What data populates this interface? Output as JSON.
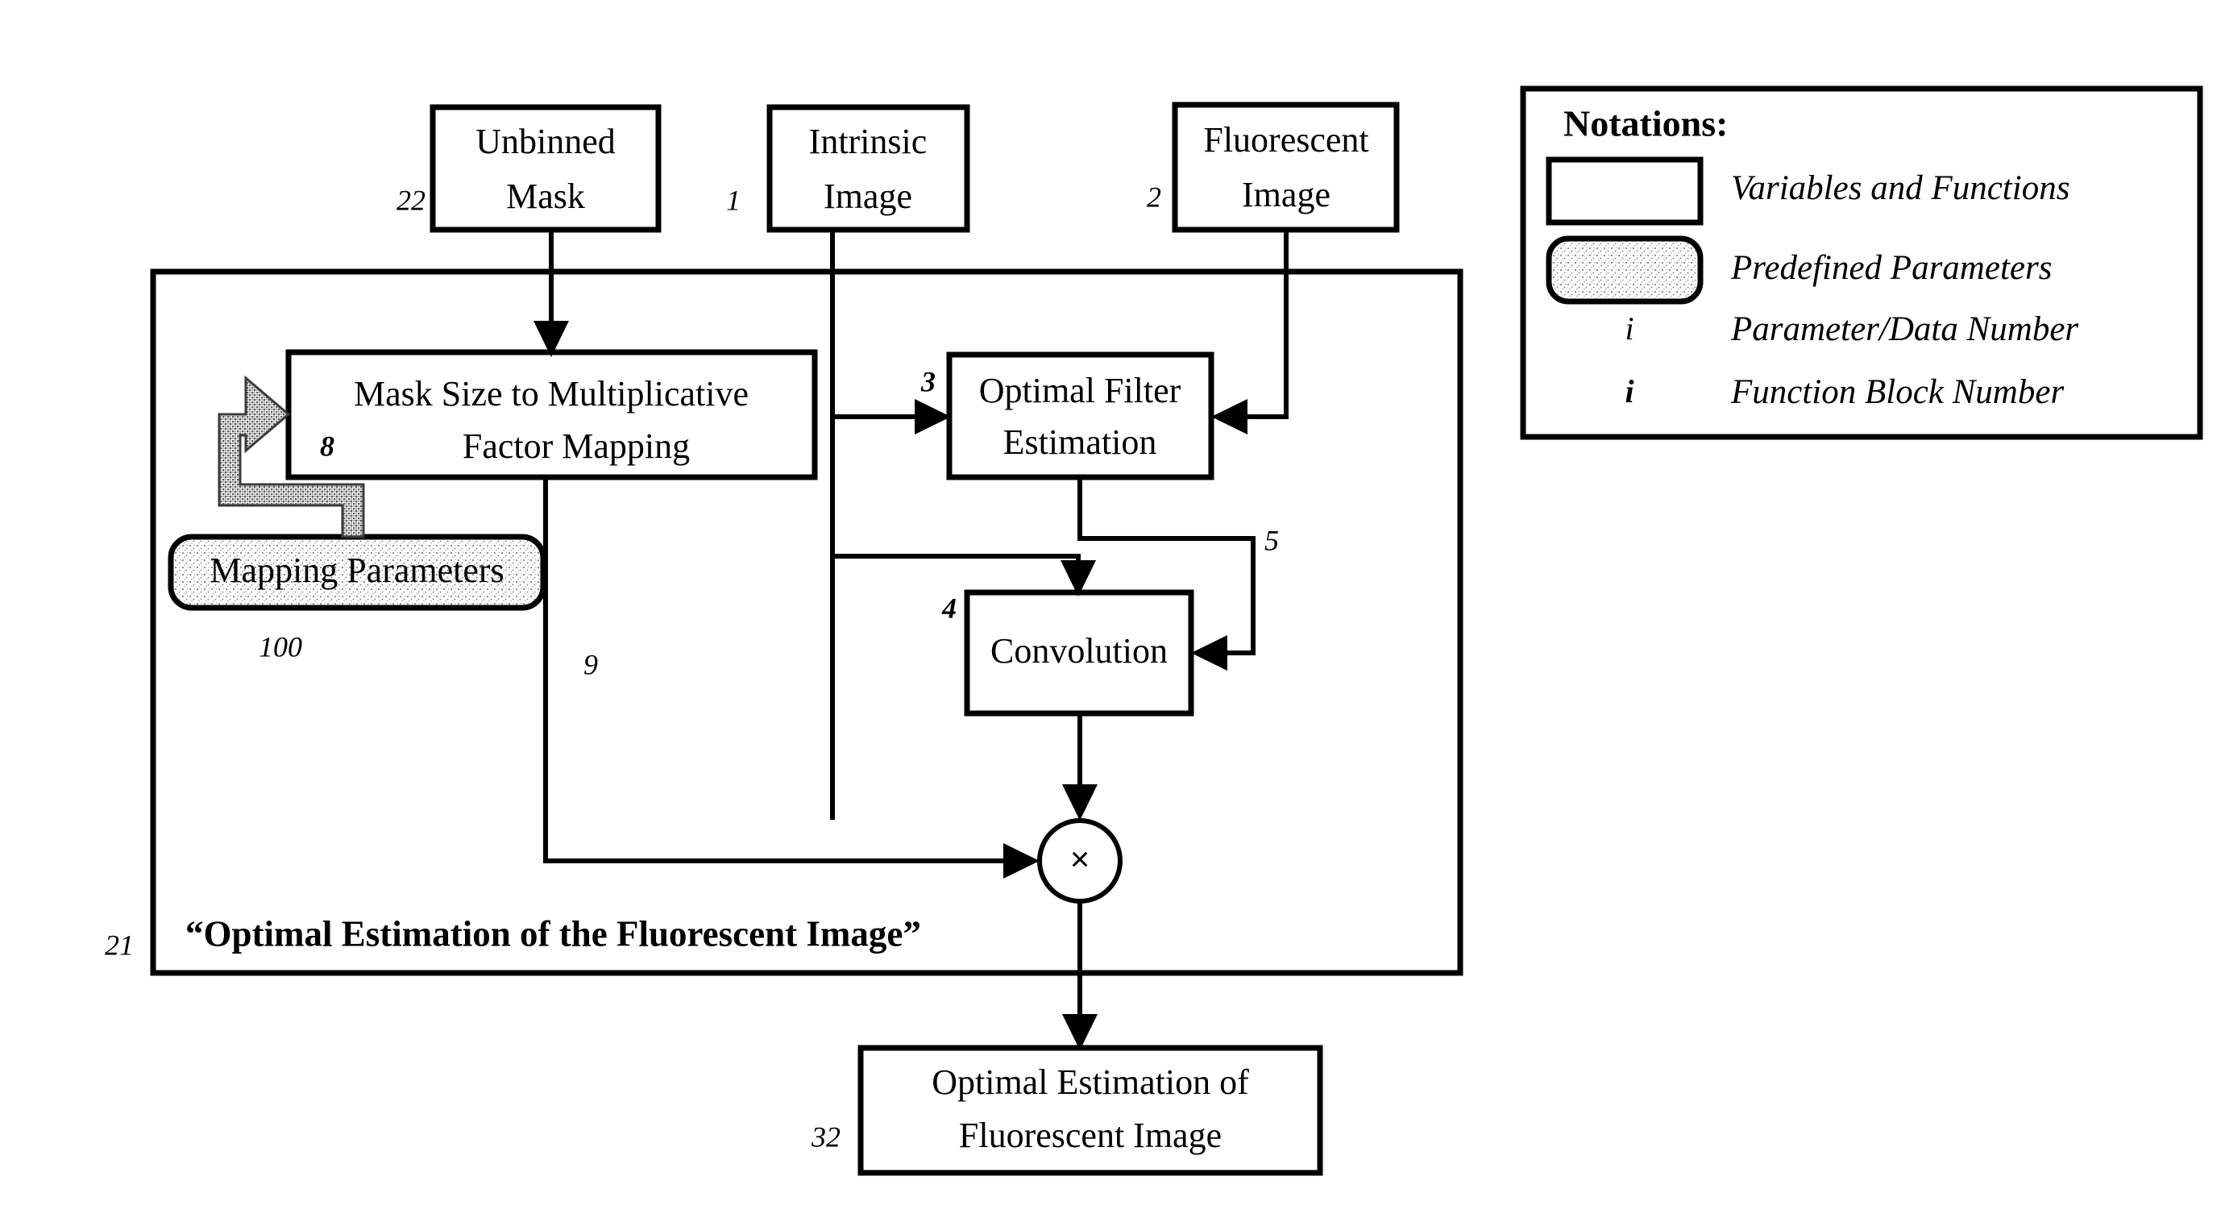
{
  "figure": {
    "type": "patent-block-diagram",
    "container": {
      "label": "“Optimal Estimation of the Fluorescent Image”",
      "number": "21"
    },
    "inputs": [
      {
        "id": "unbinned-mask",
        "label_line1": "Unbinned",
        "label_line2": "Mask",
        "number": "22"
      },
      {
        "id": "intrinsic-image",
        "label_line1": "Intrinsic",
        "label_line2": "Image",
        "number": "1"
      },
      {
        "id": "fluorescent-image",
        "label_line1": "Fluorescent",
        "label_line2": "Image",
        "number": "2"
      }
    ],
    "blocks": [
      {
        "id": "mask-size-mapping",
        "label_line1": "Mask Size to Multiplicative",
        "label_line2": "Factor Mapping",
        "number": "8"
      },
      {
        "id": "optimal-filter-estimation",
        "label_line1": "Optimal Filter",
        "label_line2": "Estimation",
        "number": "3"
      },
      {
        "id": "convolution",
        "label_line1": "Convolution",
        "label_line2": "",
        "number": "4"
      }
    ],
    "parameters": [
      {
        "id": "mapping-parameters",
        "label": "Mapping Parameters",
        "number": "100"
      }
    ],
    "operators": [
      {
        "id": "multiplier",
        "symbol": "×"
      }
    ],
    "outputs": [
      {
        "id": "optimal-estimation-output",
        "label_line1": "Optimal Estimation of",
        "label_line2": "Fluorescent Image",
        "number": "32"
      }
    ],
    "signal_numbers": [
      {
        "id": "filter-output",
        "number": "5"
      },
      {
        "id": "multiplicative-factor",
        "number": "9"
      }
    ]
  },
  "legend": {
    "title": "Notations:",
    "items": [
      {
        "symbol_type": "rect",
        "symbol_text": "",
        "label": "Variables and Functions"
      },
      {
        "symbol_type": "rounded-stippled-rect",
        "symbol_text": "",
        "label": "Predefined Parameters"
      },
      {
        "symbol_type": "italic-i",
        "symbol_text": "i",
        "label": "Parameter/Data Number"
      },
      {
        "symbol_type": "bold-italic-i",
        "symbol_text": "i",
        "label": "Function Block Number"
      }
    ]
  },
  "colors": {
    "ink": "#000000",
    "paper": "#ffffff",
    "gray_arrow": "#6e6e6e"
  }
}
